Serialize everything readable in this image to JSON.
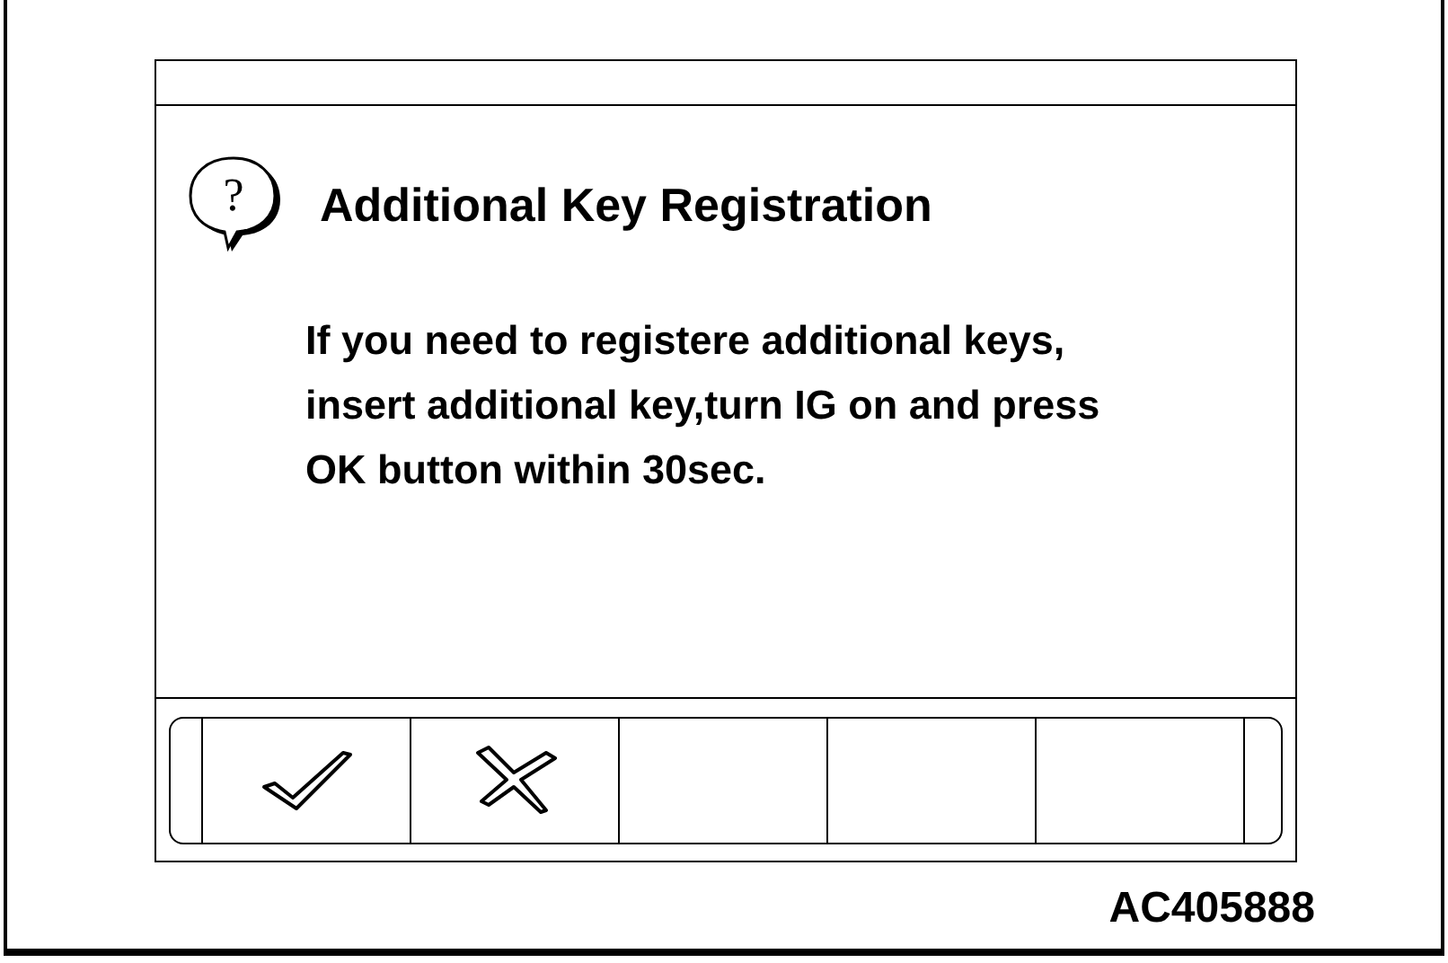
{
  "dialog": {
    "icon_glyph": "?",
    "title": "Additional Key Registration",
    "message_lines": [
      "If you need to registere additional keys,",
      "insert additional key,turn IG on and press",
      "OK button within 30sec."
    ]
  },
  "buttons": [
    {
      "kind": "check"
    },
    {
      "kind": "cross"
    },
    {
      "kind": "empty"
    },
    {
      "kind": "empty"
    },
    {
      "kind": "empty"
    }
  ],
  "figure_id": "AC405888"
}
